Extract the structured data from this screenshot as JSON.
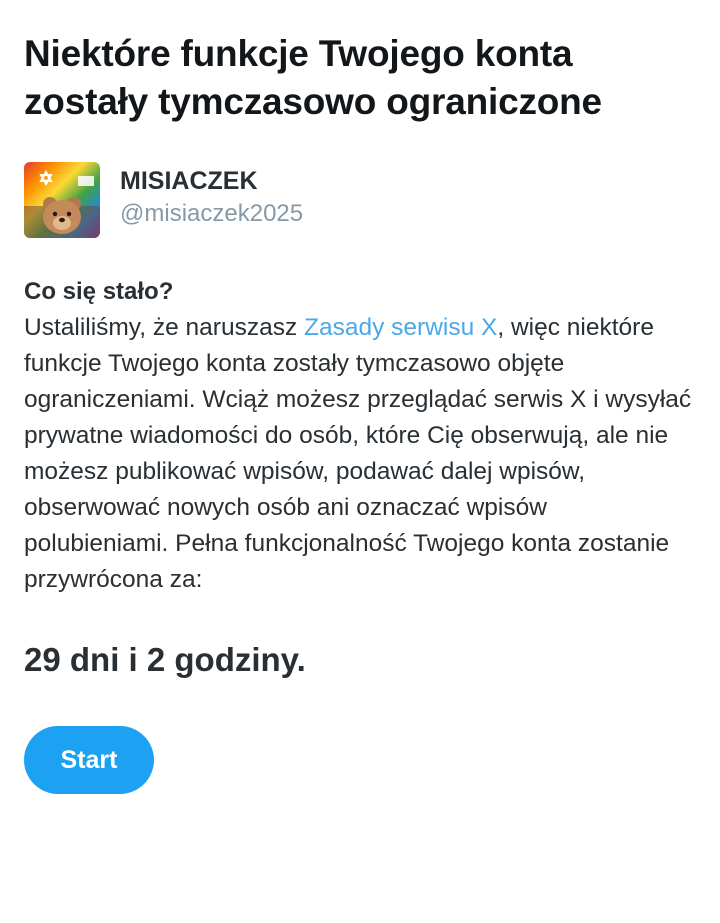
{
  "page": {
    "title_line1": "Niektóre funkcje Twojego konta",
    "title_line2": "zostały tymczasowo ograniczone"
  },
  "account": {
    "display_name": "MISIACZEK",
    "handle": "@misiaczek2025",
    "avatar_icon": "teddy-bear-rainbow-avatar"
  },
  "explanation": {
    "heading": "Co się stało?",
    "text_before_link": "Ustaliliśmy, że naruszasz ",
    "link_text": "Zasady serwisu X",
    "text_after_link": ", więc niektóre funkcje Twojego konta zostały tymczasowo objęte ograniczeniami. Wciąż możesz przeglądać serwis X i wysyłać prywatne wiadomości do osób, które Cię obserwują, ale nie możesz publikować wpisów, podawać dalej wpisów, obserwować nowych osób ani oznaczać wpisów polubieniami. Pełna funkcjonalność Twojego konta zostanie przywrócona za:"
  },
  "restriction": {
    "duration": "29 dni i 2 godziny."
  },
  "actions": {
    "start_label": "Start"
  },
  "colors": {
    "link": "#4aa8e8",
    "button": "#1da1f2",
    "handle": "#8899a6",
    "text": "#292f33"
  }
}
